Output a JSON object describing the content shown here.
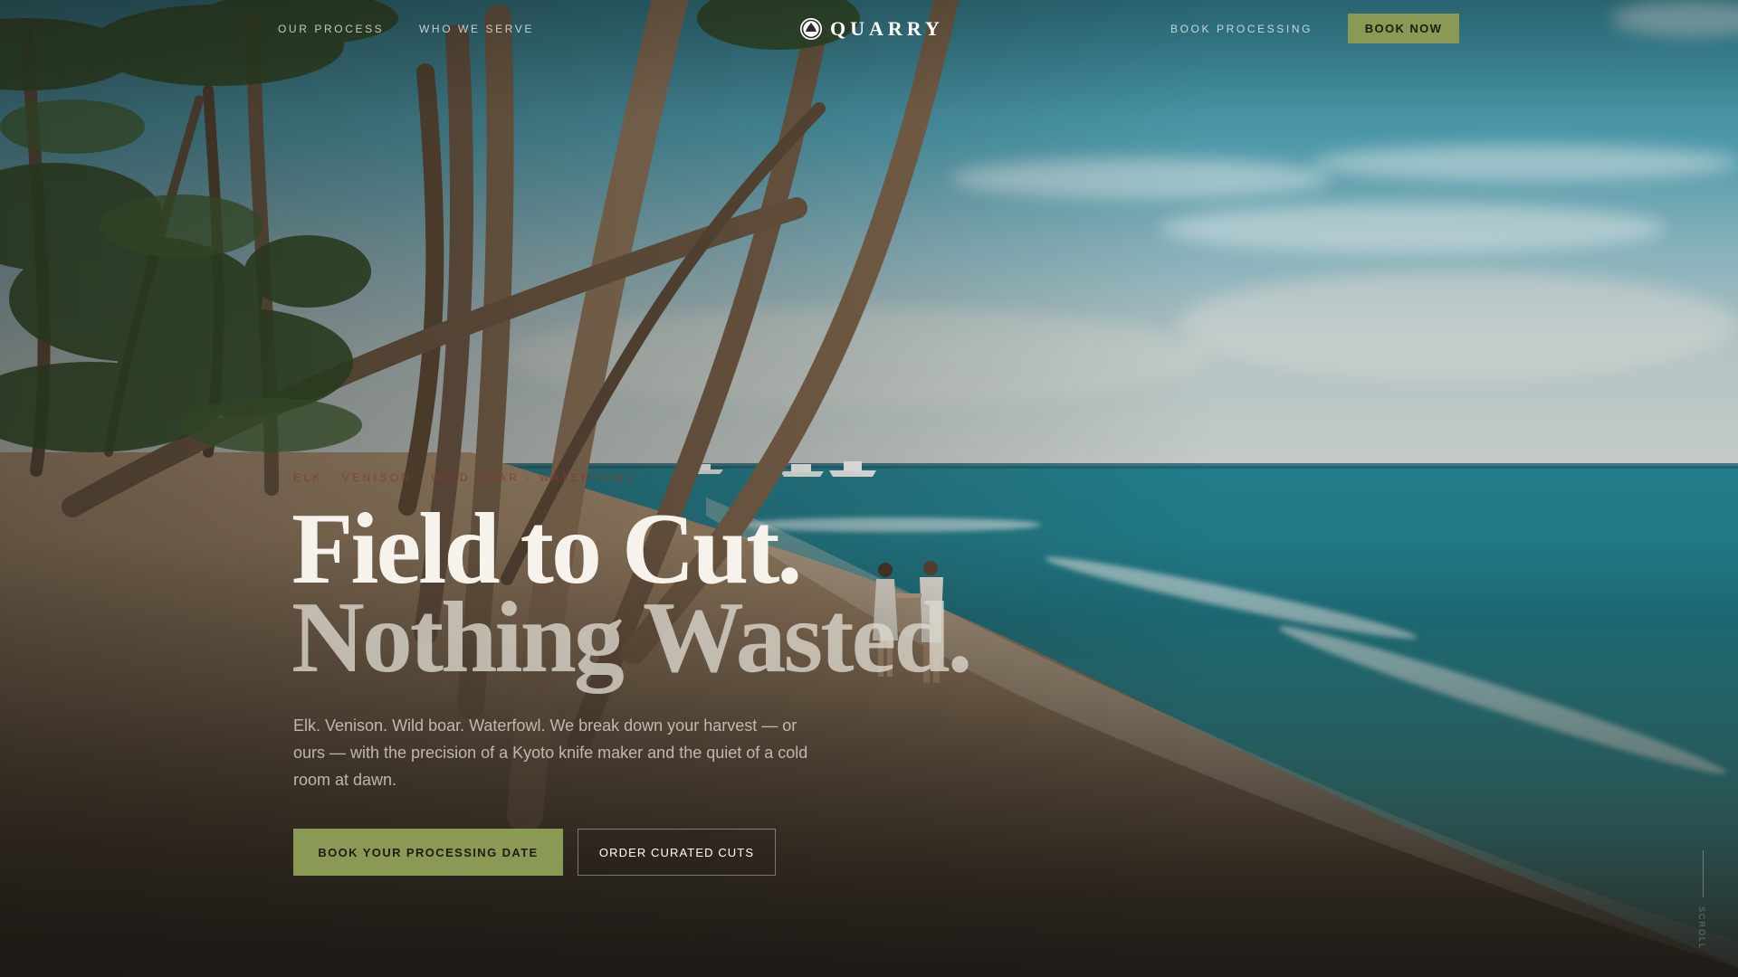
{
  "nav": {
    "left_links": [
      "OUR PROCESS",
      "WHO WE SERVE"
    ],
    "logo_text": "QUARRY",
    "right_link": "BOOK PROCESSING",
    "cta": "BOOK NOW"
  },
  "hero": {
    "eyebrow": "ELK · VENISON · WILD BOAR · WATERFOWL",
    "headline_line1": "Field to Cut.",
    "headline_line2": "Nothing Wasted.",
    "lede": "Elk. Venison. Wild boar. Waterfowl. We break down your harvest — or ours — with the precision of a Kyoto knife maker and the quiet of a cold room at dawn.",
    "primary_cta": "BOOK YOUR PROCESSING DATE",
    "secondary_cta": "ORDER CURATED CUTS"
  },
  "scroll": {
    "label": "SCROLL"
  },
  "icons": {
    "logo": "quarry-crest-icon"
  },
  "colors": {
    "accent": "#8a9a55",
    "eyebrow": "#8a3a2c"
  }
}
